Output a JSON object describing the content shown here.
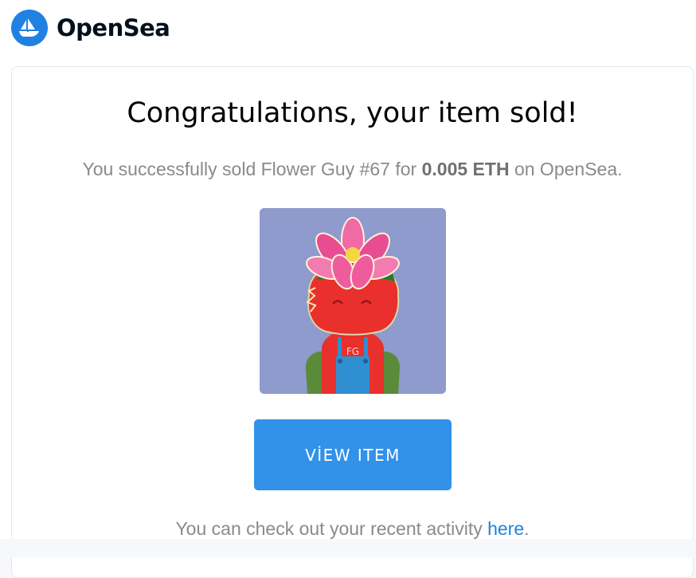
{
  "header": {
    "brand": "OpenSea",
    "logo_icon": "opensea-boat-icon",
    "logo_color": "#2081e2"
  },
  "email": {
    "title": "Congratulations, your item sold!",
    "message": {
      "prefix": "You successfully sold Flower Guy #67 for ",
      "price": "0.005 ETH",
      "suffix": " on OpenSea."
    },
    "nft_image": {
      "name": "Flower Guy #67",
      "background_color": "#8f9acd",
      "shirt_text": "FG"
    },
    "view_button_label": "VİEW ITEM",
    "view_button_color": "#3291e9",
    "activity": {
      "prefix": "You can check out your recent activity ",
      "link_text": "here",
      "suffix": "."
    }
  }
}
